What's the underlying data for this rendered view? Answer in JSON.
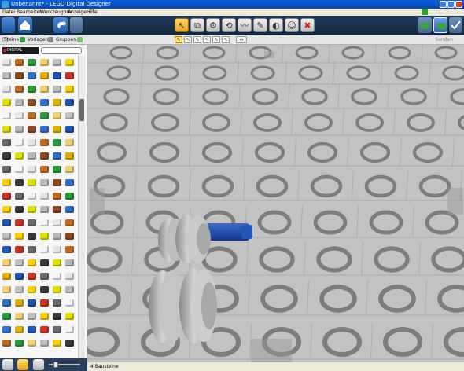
{
  "window": {
    "title": "Unbenannt* - LEGO Digital Designer"
  },
  "menu": [
    "Datei",
    "Bearbeiten",
    "Werkzeugbox",
    "Anzeige",
    "Hilfe"
  ],
  "toolbar": {
    "tools": [
      {
        "name": "select-tool",
        "glyph": "↖",
        "active": true
      },
      {
        "name": "clone-tool",
        "glyph": "⧉"
      },
      {
        "name": "hinge-tool",
        "glyph": "⚙"
      },
      {
        "name": "hinge-align-tool",
        "glyph": "⟲"
      },
      {
        "name": "flex-tool",
        "glyph": "〰"
      },
      {
        "name": "paint-tool",
        "glyph": "✎"
      },
      {
        "name": "hide-tool",
        "glyph": "◐"
      },
      {
        "name": "minifig-tool",
        "glyph": "☺"
      },
      {
        "name": "delete-tool",
        "glyph": "✖"
      }
    ]
  },
  "tabs": {
    "bricks": "Steine",
    "templates": "Vorlagen",
    "groups": "Gruppen"
  },
  "submodes": [
    "↖",
    "↖",
    "↖",
    "↖",
    "↖",
    "↖",
    "⇔"
  ],
  "send_label": "Senden",
  "palette": {
    "logo": "DIGITAL DESIGNER"
  },
  "status": {
    "brick_count": "4 Bausteine"
  },
  "colors": {
    "accent_blue": "#1848a8",
    "baseplate": "#bfbfbf",
    "window_bg": "#2a3f5e"
  }
}
